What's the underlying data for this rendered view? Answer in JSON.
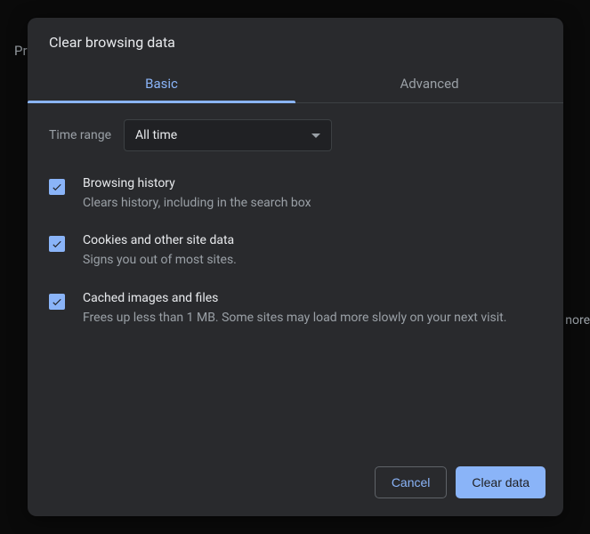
{
  "background": {
    "leftText": "Priv",
    "rightText": "nore"
  },
  "dialog": {
    "title": "Clear browsing data",
    "tabs": {
      "basic": "Basic",
      "advanced": "Advanced"
    },
    "timeRange": {
      "label": "Time range",
      "value": "All time"
    },
    "options": [
      {
        "title": "Browsing history",
        "description": "Clears history, including in the search box"
      },
      {
        "title": "Cookies and other site data",
        "description": "Signs you out of most sites."
      },
      {
        "title": "Cached images and files",
        "description": "Frees up less than 1 MB. Some sites may load more slowly on your next visit."
      }
    ],
    "buttons": {
      "cancel": "Cancel",
      "clear": "Clear data"
    }
  }
}
